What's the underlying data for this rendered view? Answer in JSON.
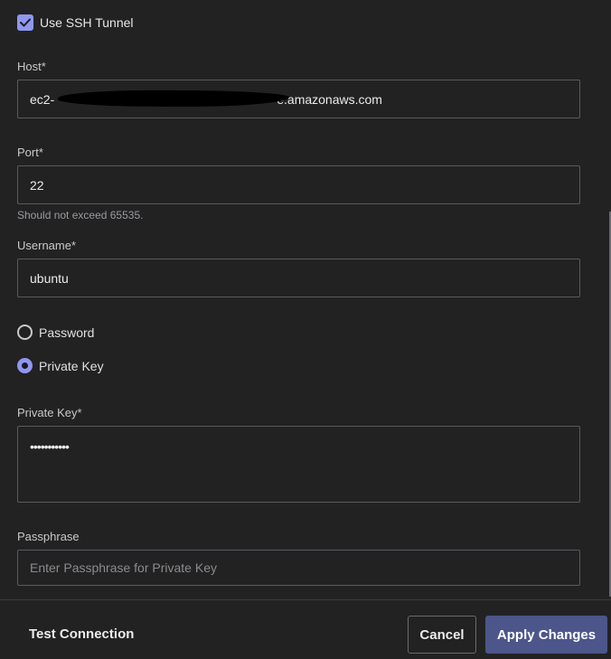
{
  "ssh_tunnel": {
    "label": "Use SSH Tunnel",
    "checked": true
  },
  "host": {
    "label": "Host*",
    "value_prefix": "ec2-",
    "value_suffix": "e.amazonaws.com"
  },
  "port": {
    "label": "Port*",
    "value": "22",
    "hint": "Should not exceed 65535."
  },
  "username": {
    "label": "Username*",
    "value": "ubuntu"
  },
  "auth_method": {
    "options": [
      {
        "label": "Password",
        "selected": false
      },
      {
        "label": "Private Key",
        "selected": true
      }
    ]
  },
  "private_key": {
    "label": "Private Key*",
    "value": "•••••••••••"
  },
  "passphrase": {
    "label": "Passphrase",
    "placeholder": "Enter Passphrase for Private Key",
    "value": ""
  },
  "footer": {
    "test_label": "Test Connection",
    "cancel_label": "Cancel",
    "apply_label": "Apply Changes"
  },
  "colors": {
    "background": "#222223",
    "accent": "#8f97f0",
    "primary_button": "#4c568b"
  }
}
